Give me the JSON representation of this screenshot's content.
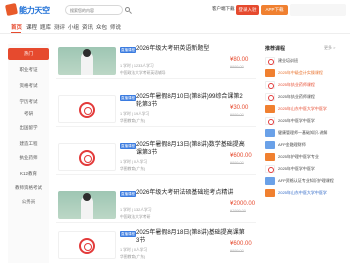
{
  "header": {
    "logo_text": "能力天空",
    "search_placeholder": "搜索您的内容",
    "client_label": "客户端下载",
    "separator": "|",
    "login_label": "登录入驻",
    "app_label": "APP下载"
  },
  "nav": {
    "tabs": [
      "首页",
      "课程",
      "题库",
      "测评",
      "小组",
      "资讯",
      "众包",
      "师说"
    ]
  },
  "sidebar": {
    "items": [
      "热门",
      "职业考证",
      "资格考试",
      "学历考试",
      "考研",
      "出国留学",
      "建造工程",
      "执业药师",
      "K12教育",
      "教师资格考试",
      "公务员"
    ]
  },
  "courses": [
    {
      "badge": "直播课程",
      "title": "2026年级大考研英语新题型",
      "meta": "1 学时  |  1233人学习",
      "provider": "中国政法大学考研英语辅导",
      "price": "¥80.00",
      "oprice": "¥999.00",
      "tag": ""
    },
    {
      "badge": "直播课程",
      "title": "2025年暑假8月10日(第8讲)99综合课第2轮第3节",
      "meta": "1 学时  |  19人学习",
      "provider": "华图教育(广东)",
      "price": "¥30.00",
      "oprice": "¥999.00",
      "tag": ""
    },
    {
      "badge": "直播课程",
      "title": "2025年暑假8月13日(第8讲)数学基础提高课第3节",
      "meta": "1 学时  |  0人学习",
      "provider": "华图教育(广东)",
      "price": "¥600.00",
      "oprice": "¥999.00",
      "tag": ""
    },
    {
      "badge": "直播课程",
      "title": "2026年级大考研法硕基础班考点精讲",
      "meta": "1 学时  |  132人学习",
      "provider": "中国政法大学考研",
      "price": "¥2000.00",
      "oprice": "¥2999.00",
      "tag": ""
    },
    {
      "badge": "直播课程",
      "title": "2025年暑假8月18日(第8讲)基础提高课第3节",
      "meta": "1 学时  |  0人学习",
      "provider": "华图教育(广东)",
      "price": "¥600.00",
      "oprice": "¥999.00",
      "tag": ""
    }
  ],
  "right": {
    "heading": "推荐课程",
    "more": "更多 >",
    "items": [
      {
        "text": "建业培训班",
        "color": "normal",
        "img": "red"
      },
      {
        "text": "2025年中级会计实操课程",
        "color": "orange",
        "img": "orange"
      },
      {
        "text": "2025年执业药师课程",
        "color": "red",
        "img": "red"
      },
      {
        "text": "2025年执业药师课程",
        "color": "normal",
        "img": "red"
      },
      {
        "text": "2025年山东中医大学中医学",
        "color": "red",
        "img": "orange"
      },
      {
        "text": "2025年中医学中医学",
        "color": "normal",
        "img": "red"
      },
      {
        "text": "健康管理师一基础知识-讲解",
        "color": "normal",
        "img": "blue"
      },
      {
        "text": "AFP金融理财师",
        "color": "normal",
        "img": "blue"
      },
      {
        "text": "2025年护理中医学专业",
        "color": "normal",
        "img": "orange"
      },
      {
        "text": "2025年中医学中医学",
        "color": "normal",
        "img": "red"
      },
      {
        "text": "AFP资格认证专业知识护理课程",
        "color": "normal",
        "img": "blue"
      },
      {
        "text": "2025年山东中医大学中医学",
        "color": "blue",
        "img": "orange"
      }
    ]
  }
}
